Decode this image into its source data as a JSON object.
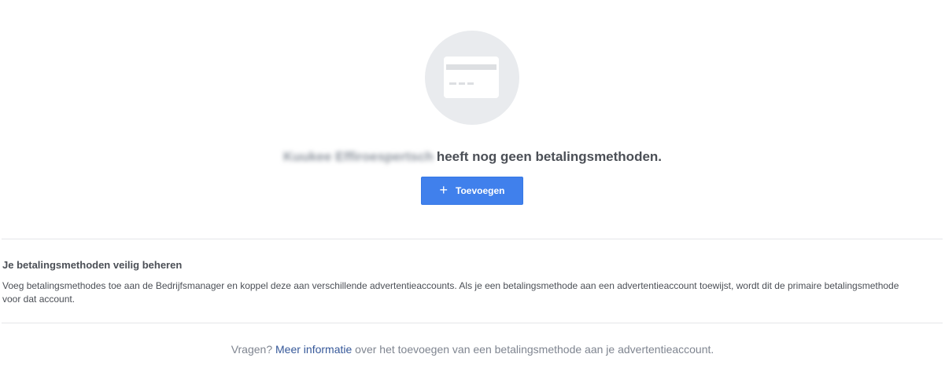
{
  "empty_state": {
    "account_name": "Kuukee Effiroespertsch",
    "message": "heeft nog geen betalingsmethoden.",
    "add_button_label": "Toevoegen",
    "add_button_icon": "plus-icon",
    "illustration_icon": "credit-card-icon"
  },
  "info": {
    "title": "Je betalingsmethoden veilig beheren",
    "body": "Voeg betalingsmethodes toe aan de Bedrijfsmanager en koppel deze aan verschillende advertentieaccounts. Als je een betalingsmethode aan een advertentieaccount toewijst, wordt dit de primaire betalingsmethode voor dat account."
  },
  "footer": {
    "prefix": "Vragen?",
    "link_label": "Meer informatie",
    "suffix": "over het toevoegen van een betalingsmethode aan je advertentieaccount."
  },
  "colors": {
    "primary_button": "#4080ec",
    "link": "#365899",
    "illustration_bg": "#e9ebee"
  }
}
